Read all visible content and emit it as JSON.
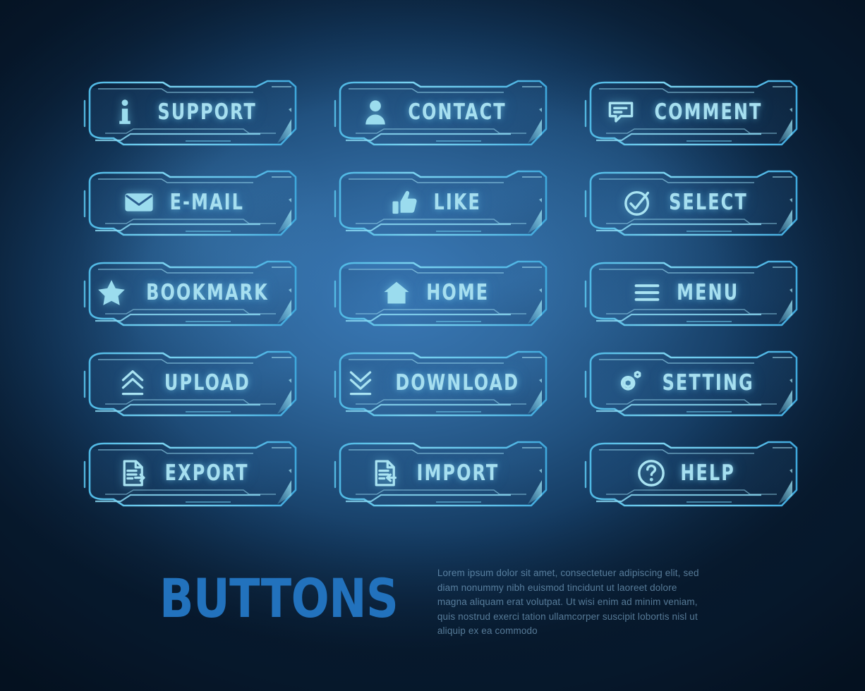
{
  "theme": {
    "bg_dark": "#081c31",
    "bg_mid": "#21517f",
    "bg_light": "#3a7ab8",
    "accent_cyan": "#a6dff0",
    "frame_stroke": "#6fc7e8",
    "title_blue": "#2272bd",
    "body_text": "#86b4d6"
  },
  "buttons": [
    {
      "label": "SUPPORT",
      "icon": "info-icon",
      "name": "support-button"
    },
    {
      "label": "CONTACT",
      "icon": "person-icon",
      "name": "contact-button"
    },
    {
      "label": "COMMENT",
      "icon": "speech-bubble-icon",
      "name": "comment-button"
    },
    {
      "label": "E-MAIL",
      "icon": "envelope-icon",
      "name": "email-button"
    },
    {
      "label": "LIKE",
      "icon": "thumbs-up-icon",
      "name": "like-button"
    },
    {
      "label": "SELECT",
      "icon": "check-circle-icon",
      "name": "select-button"
    },
    {
      "label": "BOOKMARK",
      "icon": "star-icon",
      "name": "bookmark-button"
    },
    {
      "label": "HOME",
      "icon": "home-icon",
      "name": "home-button"
    },
    {
      "label": "MENU",
      "icon": "hamburger-icon",
      "name": "menu-button"
    },
    {
      "label": "UPLOAD",
      "icon": "chevron-up-double-icon",
      "name": "upload-button"
    },
    {
      "label": "DOWNLOAD",
      "icon": "chevron-down-double-icon",
      "name": "download-button"
    },
    {
      "label": "SETTING",
      "icon": "gear-icon",
      "name": "setting-button"
    },
    {
      "label": "EXPORT",
      "icon": "document-out-icon",
      "name": "export-button"
    },
    {
      "label": "IMPORT",
      "icon": "document-in-icon",
      "name": "import-button"
    },
    {
      "label": "HELP",
      "icon": "question-circle-icon",
      "name": "help-button"
    }
  ],
  "footer": {
    "title": "BUTTONS",
    "body": "Lorem ipsum dolor sit amet, consectetuer adipiscing elit, sed diam nonummy nibh euismod tincidunt ut laoreet dolore magna aliquam erat volutpat. Ut wisi enim ad minim veniam, quis nostrud exerci tation ullamcorper suscipit lobortis nisl ut aliquip ex ea commodo"
  }
}
